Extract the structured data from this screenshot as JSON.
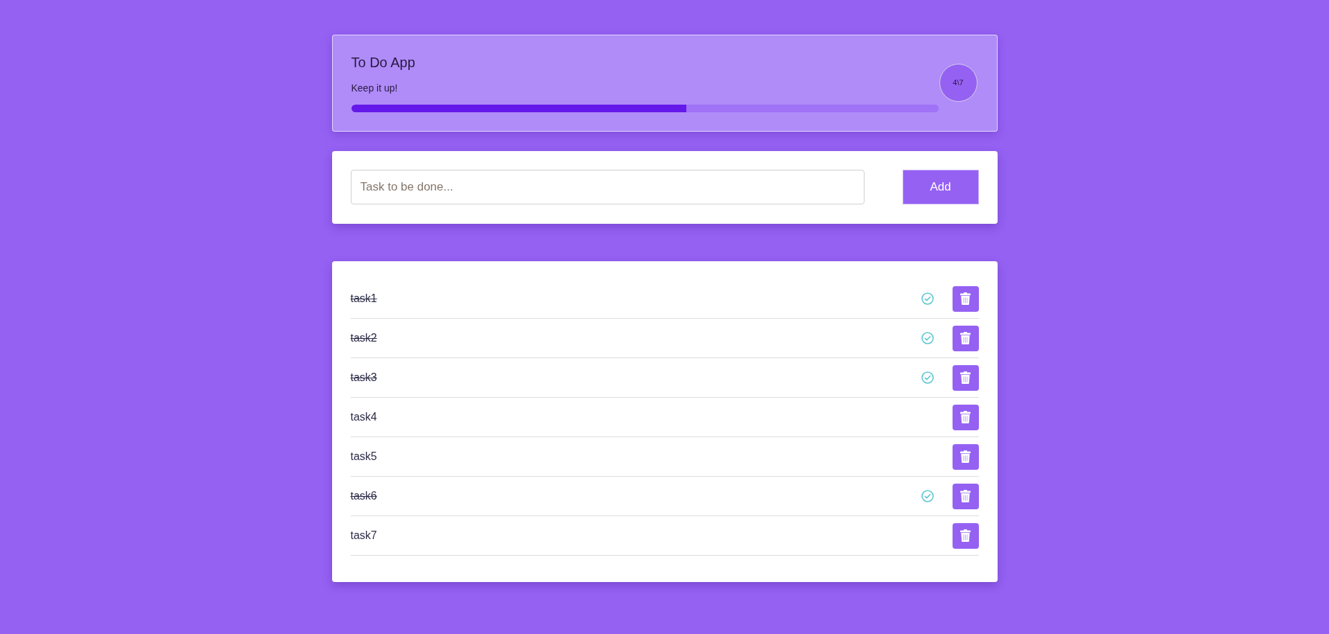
{
  "header": {
    "title": "To Do App",
    "message": "Keep it up!",
    "progress": {
      "level": 0.571
    },
    "counter": "4\\7"
  },
  "new_task": {
    "placeholder": "Task to be done...",
    "button": "Add"
  },
  "tasks": [
    {
      "text": "task1",
      "done": true
    },
    {
      "text": "task2",
      "done": true
    },
    {
      "text": "task3",
      "done": true
    },
    {
      "text": "task4",
      "done": false
    },
    {
      "text": "task5",
      "done": false
    },
    {
      "text": "task6",
      "done": true
    },
    {
      "text": "task7",
      "done": false
    }
  ]
}
